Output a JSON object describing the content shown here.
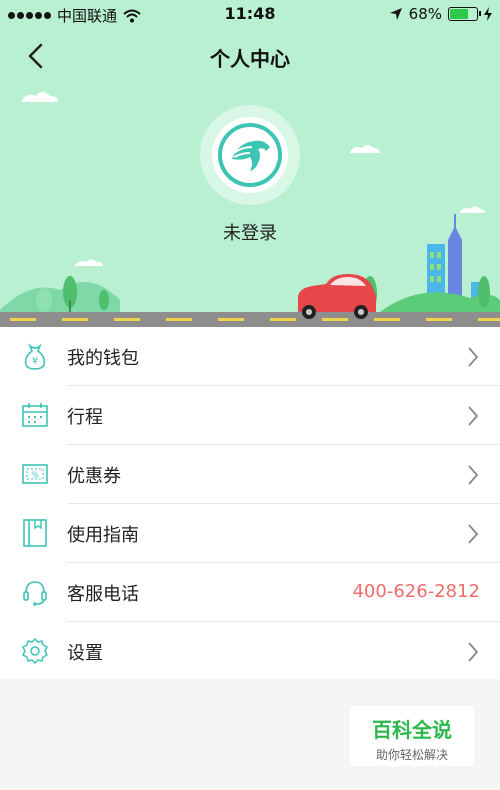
{
  "status_bar": {
    "carrier": "中国联通",
    "time": "11:48",
    "battery": "68%",
    "battery_level": 0.68
  },
  "header": {
    "title": "个人中心"
  },
  "profile": {
    "login_status": "未登录"
  },
  "menu": {
    "items": [
      {
        "label": "我的钱包",
        "icon": "wallet-icon"
      },
      {
        "label": "行程",
        "icon": "calendar-icon"
      },
      {
        "label": "优惠券",
        "icon": "coupon-icon"
      },
      {
        "label": "使用指南",
        "icon": "guide-book-icon"
      },
      {
        "label": "客服电话",
        "icon": "headset-icon",
        "value": "400-626-2812"
      },
      {
        "label": "设置",
        "icon": "gear-icon"
      }
    ]
  },
  "watermark": {
    "title": "百科全说",
    "subtitle": "助你轻松解决"
  },
  "colors": {
    "hero_bg": "#b9f0d2",
    "icon_accent": "#3cc4b4",
    "phone_text": "#f26b6b",
    "car": "#e8474a"
  }
}
